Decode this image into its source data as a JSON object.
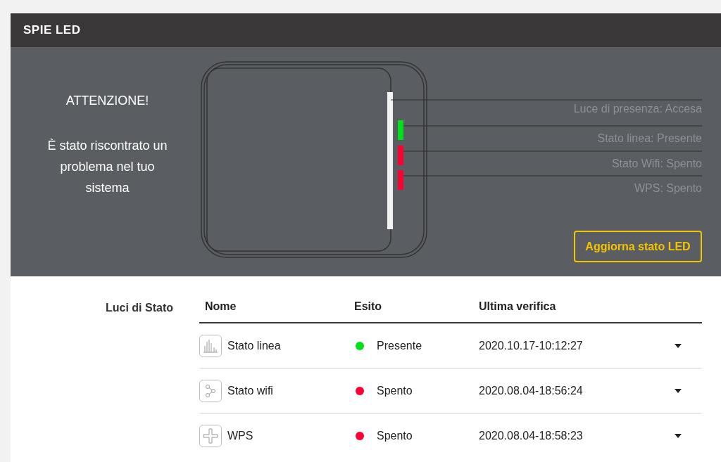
{
  "header": {
    "title": "SPIE LED"
  },
  "alert": {
    "title": "ATTENZIONE!",
    "message": "È stato riscontrato un problema nel tuo sistema"
  },
  "leds": [
    {
      "kind": "strip",
      "color": "#f2f2f2",
      "label": "Luce di presenza: Accesa"
    },
    {
      "kind": "lamp",
      "color": "#00e01a",
      "label": "Stato linea: Presente"
    },
    {
      "kind": "lamp",
      "color": "#ff0033",
      "label": "Stato Wifi: Spento"
    },
    {
      "kind": "lamp",
      "color": "#ff0033",
      "label": "WPS: Spento"
    }
  ],
  "refresh_button": "Aggiorna stato LED",
  "table": {
    "section_label": "Luci di Stato",
    "columns": [
      "Nome",
      "Esito",
      "Ultima verifica"
    ],
    "rows": [
      {
        "kind": "bars",
        "name": "Stato linea",
        "status": "Presente",
        "color": "#00e01a",
        "checked_at": "2020.10.17-10:12:27"
      },
      {
        "kind": "share",
        "name": "Stato wifi",
        "status": "Spento",
        "color": "#ff0033",
        "checked_at": "2020.08.04-18:56:24"
      },
      {
        "kind": "plus",
        "name": "WPS",
        "status": "Spento",
        "color": "#ff0033",
        "checked_at": "2020.08.04-18:58:23"
      }
    ]
  }
}
